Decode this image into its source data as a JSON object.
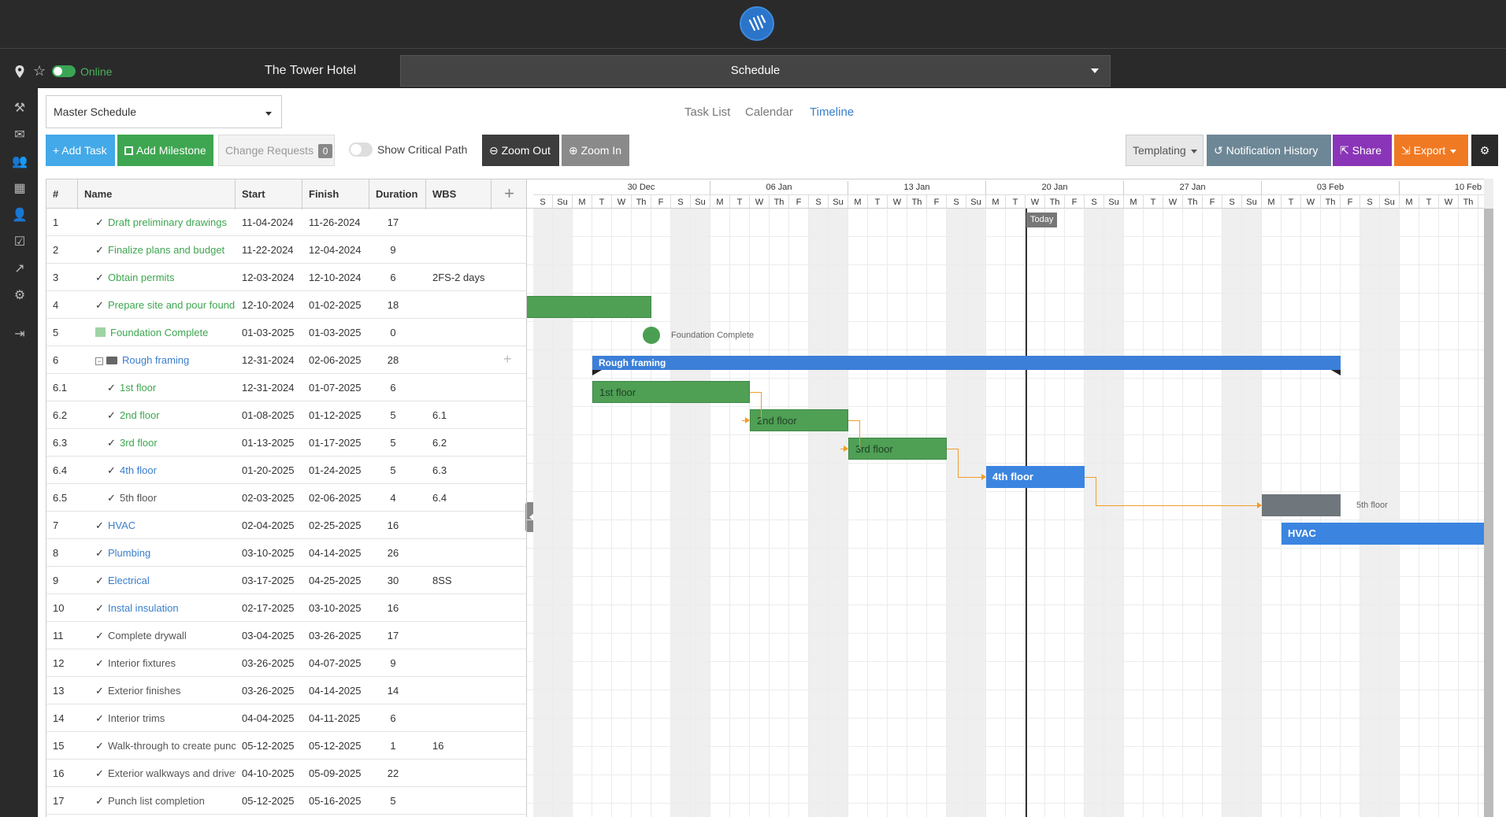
{
  "app": {
    "project_name": "The Tower Hotel",
    "module": "Schedule",
    "status": "Online"
  },
  "toolbar": {
    "schedule_select": "Master Schedule",
    "views": [
      "Task List",
      "Calendar",
      "Timeline"
    ],
    "active_view": "Timeline",
    "add_task": "+ Add Task",
    "add_milestone": "Add Milestone",
    "change_requests": "Change Requests",
    "change_requests_count": "0",
    "show_critical_path": "Show Critical Path",
    "zoom_out": "Zoom Out",
    "zoom_in": "Zoom In",
    "templating": "Templating",
    "notification_history": "Notification History",
    "share": "Share",
    "export": "Export"
  },
  "grid": {
    "columns": [
      "#",
      "Name",
      "Start",
      "Finish",
      "Duration",
      "WBS"
    ],
    "rows": [
      {
        "num": "1",
        "name": "Draft preliminary drawings",
        "start": "11-04-2024",
        "finish": "11-26-2024",
        "duration": "17",
        "wbs": "",
        "style": "green",
        "indent": 0
      },
      {
        "num": "2",
        "name": "Finalize plans and budget",
        "start": "11-22-2024",
        "finish": "12-04-2024",
        "duration": "9",
        "wbs": "",
        "style": "green",
        "indent": 0
      },
      {
        "num": "3",
        "name": "Obtain permits",
        "start": "12-03-2024",
        "finish": "12-10-2024",
        "duration": "6",
        "wbs": "2FS-2 days",
        "style": "green",
        "indent": 0
      },
      {
        "num": "4",
        "name": "Prepare site and pour foundation",
        "start": "12-10-2024",
        "finish": "01-02-2025",
        "duration": "18",
        "wbs": "",
        "style": "green",
        "indent": 0
      },
      {
        "num": "5",
        "name": "Foundation Complete",
        "start": "01-03-2025",
        "finish": "01-03-2025",
        "duration": "0",
        "wbs": "",
        "style": "green",
        "indent": 0,
        "kind": "milestone"
      },
      {
        "num": "6",
        "name": "Rough framing",
        "start": "12-31-2024",
        "finish": "02-06-2025",
        "duration": "28",
        "wbs": "",
        "style": "blue",
        "indent": 0,
        "kind": "summary"
      },
      {
        "num": "6.1",
        "name": "1st floor",
        "start": "12-31-2024",
        "finish": "01-07-2025",
        "duration": "6",
        "wbs": "",
        "style": "green",
        "indent": 1
      },
      {
        "num": "6.2",
        "name": "2nd floor",
        "start": "01-08-2025",
        "finish": "01-12-2025",
        "duration": "5",
        "wbs": "6.1",
        "style": "green",
        "indent": 1
      },
      {
        "num": "6.3",
        "name": "3rd floor",
        "start": "01-13-2025",
        "finish": "01-17-2025",
        "duration": "5",
        "wbs": "6.2",
        "style": "green",
        "indent": 1
      },
      {
        "num": "6.4",
        "name": "4th floor",
        "start": "01-20-2025",
        "finish": "01-24-2025",
        "duration": "5",
        "wbs": "6.3",
        "style": "blue",
        "indent": 1
      },
      {
        "num": "6.5",
        "name": "5th floor",
        "start": "02-03-2025",
        "finish": "02-06-2025",
        "duration": "4",
        "wbs": "6.4",
        "style": "gray",
        "indent": 1
      },
      {
        "num": "7",
        "name": "HVAC",
        "start": "02-04-2025",
        "finish": "02-25-2025",
        "duration": "16",
        "wbs": "",
        "style": "blue",
        "indent": 0
      },
      {
        "num": "8",
        "name": "Plumbing",
        "start": "03-10-2025",
        "finish": "04-14-2025",
        "duration": "26",
        "wbs": "",
        "style": "blue",
        "indent": 0
      },
      {
        "num": "9",
        "name": "Electrical",
        "start": "03-17-2025",
        "finish": "04-25-2025",
        "duration": "30",
        "wbs": "8SS",
        "style": "blue",
        "indent": 0
      },
      {
        "num": "10",
        "name": "Instal insulation",
        "start": "02-17-2025",
        "finish": "03-10-2025",
        "duration": "16",
        "wbs": "",
        "style": "blue",
        "indent": 0
      },
      {
        "num": "11",
        "name": "Complete drywall",
        "start": "03-04-2025",
        "finish": "03-26-2025",
        "duration": "17",
        "wbs": "",
        "style": "gray",
        "indent": 0
      },
      {
        "num": "12",
        "name": "Interior fixtures",
        "start": "03-26-2025",
        "finish": "04-07-2025",
        "duration": "9",
        "wbs": "",
        "style": "gray",
        "indent": 0
      },
      {
        "num": "13",
        "name": "Exterior finishes",
        "start": "03-26-2025",
        "finish": "04-14-2025",
        "duration": "14",
        "wbs": "",
        "style": "gray",
        "indent": 0
      },
      {
        "num": "14",
        "name": "Interior trims",
        "start": "04-04-2025",
        "finish": "04-11-2025",
        "duration": "6",
        "wbs": "",
        "style": "gray",
        "indent": 0
      },
      {
        "num": "15",
        "name": "Walk-through to create punch list",
        "start": "05-12-2025",
        "finish": "05-12-2025",
        "duration": "1",
        "wbs": "16",
        "style": "gray",
        "indent": 0
      },
      {
        "num": "16",
        "name": "Exterior walkways and driveway",
        "start": "04-10-2025",
        "finish": "05-09-2025",
        "duration": "22",
        "wbs": "",
        "style": "gray",
        "indent": 0
      },
      {
        "num": "17",
        "name": "Punch list completion",
        "start": "05-12-2025",
        "finish": "05-16-2025",
        "duration": "5",
        "wbs": "",
        "style": "gray",
        "indent": 0
      }
    ]
  },
  "timeline": {
    "weeks": [
      "30 Dec",
      "06 Jan",
      "13 Jan",
      "20 Jan",
      "27 Jan",
      "03 Feb",
      "10 Feb"
    ],
    "day_letters": [
      "M",
      "T",
      "W",
      "Th",
      "F",
      "S",
      "Su"
    ],
    "first_days": [
      "S",
      "Su"
    ],
    "today_label": "Today",
    "today_date": "2025-01-22",
    "bars": [
      {
        "row": 3,
        "label": "",
        "start": "2024-12-10",
        "end": "2025-01-02",
        "style": "green"
      },
      {
        "row": 4,
        "label": "Foundation Complete",
        "start": "2025-01-03",
        "end": "2025-01-03",
        "style": "milestone"
      },
      {
        "row": 5,
        "label": "Rough framing",
        "start": "2024-12-31",
        "end": "2025-02-06",
        "style": "summary"
      },
      {
        "row": 6,
        "label": "1st floor",
        "start": "2024-12-31",
        "end": "2025-01-07",
        "style": "green"
      },
      {
        "row": 7,
        "label": "2nd floor",
        "start": "2025-01-08",
        "end": "2025-01-12",
        "style": "green"
      },
      {
        "row": 8,
        "label": "3rd floor",
        "start": "2025-01-13",
        "end": "2025-01-17",
        "style": "green"
      },
      {
        "row": 9,
        "label": "4th floor",
        "start": "2025-01-20",
        "end": "2025-01-24",
        "style": "blue"
      },
      {
        "row": 10,
        "label": "5th floor",
        "start": "2025-02-03",
        "end": "2025-02-06",
        "style": "gray"
      },
      {
        "row": 11,
        "label": "HVAC",
        "start": "2025-02-04",
        "end": "2025-02-25",
        "style": "blue"
      }
    ]
  },
  "colors": {
    "green": "#4f9f55",
    "blue": "#3b85e0",
    "gray": "#6f767c",
    "dependency": "#f29c2a"
  }
}
